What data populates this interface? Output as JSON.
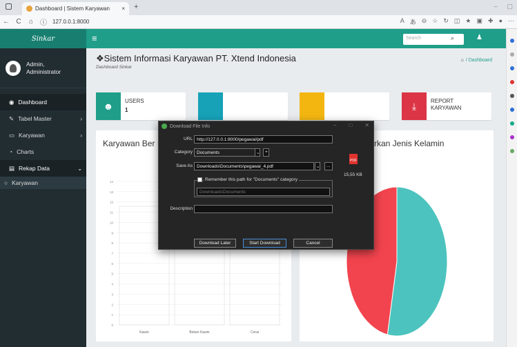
{
  "browser": {
    "tab_title": "Dashboard | Sistem Karyawan",
    "tab_close": "×",
    "new_tab": "+",
    "url": "127.0.0.1:8000",
    "win_min": "–",
    "win_max": "▢",
    "nav_back": "←",
    "nav_reload": "C",
    "nav_home": "⌂"
  },
  "app": {
    "brand": "Sinkar",
    "search_placeholder": "Search"
  },
  "sidebar": {
    "user_name": "Admin,",
    "user_role": "Administrator",
    "items": [
      {
        "label": "Dashboard",
        "icon": "dashboard-icon",
        "glyph": "◉"
      },
      {
        "label": "Tabel Master",
        "icon": "edit-icon",
        "glyph": "✎",
        "chevron": "›"
      },
      {
        "label": "Karyawan",
        "icon": "monitor-icon",
        "glyph": "▭",
        "chevron": "›"
      },
      {
        "label": "Charts",
        "icon": "pie-chart-icon",
        "glyph": "◔"
      },
      {
        "label": "Rekap Data",
        "icon": "file-icon",
        "glyph": "▤",
        "chevron": "⌄"
      },
      {
        "label": "Karyawan",
        "icon": "circle-icon",
        "glyph": "○"
      }
    ]
  },
  "page": {
    "title": "Sistem Informasi Karyawan PT. Xtend Indonesia",
    "subtitle": "Dashboard Sinkar",
    "breadcrumb": "/ Dashboard"
  },
  "cards": [
    {
      "label": "USERS",
      "value": "1",
      "color": "#1f9e8a"
    },
    {
      "label": "",
      "value": "",
      "color": "#17a2b8"
    },
    {
      "label": "",
      "value": "",
      "color": "#f3b611"
    },
    {
      "label": "REPORT",
      "label2": "KARYAWAN",
      "value": "",
      "color": "#dc3545"
    }
  ],
  "chart_left": {
    "title": "Karyawan Ber",
    "y_ticks": [
      "14",
      "13",
      "12",
      "11",
      "10",
      "9",
      "8",
      "7",
      "6",
      "5",
      "4",
      "3",
      "2",
      "1",
      "0"
    ],
    "x_ticks": [
      "Kawin",
      "Belum Kawin",
      "Cerai"
    ]
  },
  "chart_right": {
    "title": "rkan Jenis Kelamin"
  },
  "chart_data": [
    {
      "type": "bar",
      "title": "Karyawan Ber",
      "categories": [
        "Kawin",
        "Belum Kawin",
        "Cerai"
      ],
      "ylim": [
        0,
        14
      ],
      "grid": true
    },
    {
      "type": "pie",
      "title": "rkan Jenis Kelamin",
      "slices": [
        {
          "value": 53,
          "color": "#4cc3be"
        },
        {
          "value": 47,
          "color": "#f2444e"
        }
      ]
    }
  ],
  "dialog": {
    "title": "Download File Info",
    "url_label": "URL",
    "url_value": "http://127.0.0.1:8000/pegawai/pdf",
    "category_label": "Category",
    "category_value": "Documents",
    "saveas_label": "Save As",
    "saveas_value": "Downloads\\Documents\\pegawai_4.pdf",
    "remember_label": "Remember this path for \"Documents\" category",
    "remember_path": "Downloads\\Documents",
    "description_label": "Description",
    "file_size": "15,55 KB",
    "pdf_label": "PDF",
    "btn_later": "Download Later",
    "btn_start": "Start Download",
    "btn_cancel": "Cancel",
    "add_category": "+",
    "browse": "...",
    "dropdown": "⌄",
    "win_min": "–",
    "win_max": "□",
    "win_close": "✕"
  }
}
